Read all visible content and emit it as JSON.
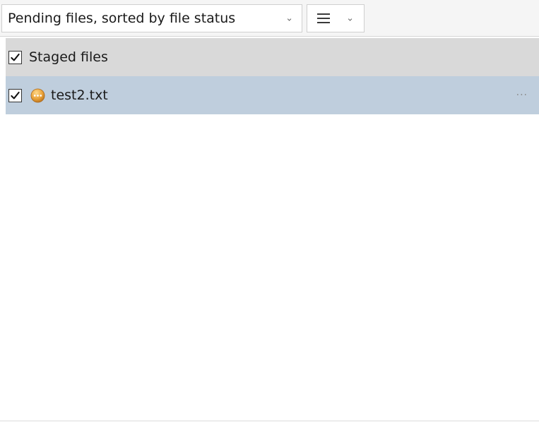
{
  "toolbar": {
    "view_dropdown_label": "Pending files, sorted by file status",
    "chevron_glyph": "⌄",
    "list_view_icon": "list-lines-icon"
  },
  "groups": [
    {
      "label": "Staged files",
      "checked": true,
      "files": [
        {
          "name": "test2.txt",
          "checked": true,
          "status_icon": "modified-status-icon",
          "status_color": "#e8a23a",
          "more_label": "···"
        }
      ]
    }
  ],
  "colors": {
    "group_header_bg": "#d9d9d9",
    "selected_row_bg": "#bfcedd",
    "toolbar_bg": "#f5f5f5"
  }
}
